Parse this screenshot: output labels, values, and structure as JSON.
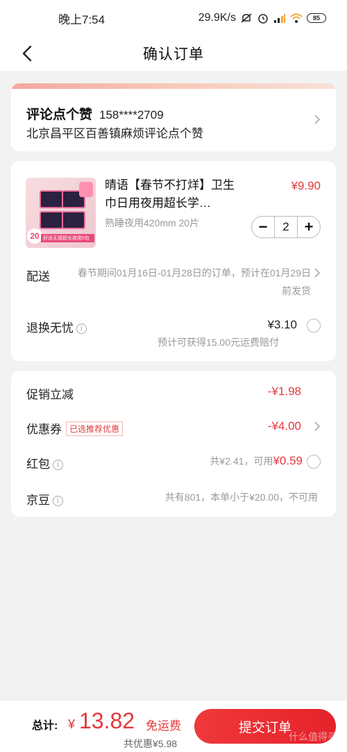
{
  "status_bar": {
    "time": "晚上7:54",
    "speed": "29.9K/s",
    "battery": "85"
  },
  "nav": {
    "title": "确认订单"
  },
  "address": {
    "name": "评论点个赞",
    "phone": "158****2709",
    "detail": "北京昌平区百善镇麻烦评论点个赞"
  },
  "product": {
    "title": "晴语【春节不打烊】卫生巾日用夜用超长学…",
    "spec": "熟睡夜用420mm  20片",
    "price": "¥9.90",
    "quantity": "2",
    "minus": "−",
    "plus": "+",
    "image_badge": "20",
    "image_strip": "舒适无感超长夜用5包"
  },
  "shipping": {
    "label": "配送",
    "text": "春节期间01月16日-01月28日的订单，预计在01月29日前发货"
  },
  "returns": {
    "label": "退换无忧",
    "price": "¥3.10",
    "sub": "预计可获得15.00元运费赔付"
  },
  "promo": {
    "discount_label": "促销立减",
    "discount_value": "-¥1.98",
    "coupon_label": "优惠券",
    "coupon_tag": "已选推荐优惠",
    "coupon_value": "-¥4.00",
    "hongbao_label": "红包",
    "hongbao_total": "共¥2.41，可用",
    "hongbao_avail": "¥0.59",
    "jingdou_label": "京豆",
    "jingdou_text": "共有801，本单小于¥20.00，不可用"
  },
  "bottom": {
    "total_label": "总计:",
    "yen": "¥",
    "total_value": "13.82",
    "free_shipping": "免运费",
    "saved": "共优惠¥5.98",
    "submit": "提交订单",
    "watermark": "什么值得买"
  },
  "colors": {
    "accent": "#e4393c",
    "background": "#f2f2f2"
  }
}
